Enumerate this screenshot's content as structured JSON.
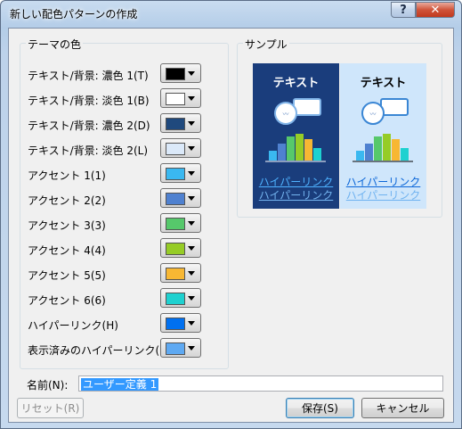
{
  "window": {
    "title": "新しい配色パターンの作成"
  },
  "titlebar": {
    "help_icon": "?",
    "close_icon": "✕"
  },
  "theme_colors": {
    "title": "テーマの色",
    "items": [
      {
        "label": "テキスト/背景: 濃色 1(T)",
        "color": "#000000"
      },
      {
        "label": "テキスト/背景: 淡色 1(B)",
        "color": "#ffffff"
      },
      {
        "label": "テキスト/背景: 濃色 2(D)",
        "color": "#1f497d"
      },
      {
        "label": "テキスト/背景: 淡色 2(L)",
        "color": "#dbe9f9"
      },
      {
        "label": "アクセント 1(1)",
        "color": "#3ab8f0"
      },
      {
        "label": "アクセント 2(2)",
        "color": "#4f81d0"
      },
      {
        "label": "アクセント 3(3)",
        "color": "#56c86b"
      },
      {
        "label": "アクセント 4(4)",
        "color": "#96cc26"
      },
      {
        "label": "アクセント 5(5)",
        "color": "#f7b733"
      },
      {
        "label": "アクセント 6(6)",
        "color": "#1ed1d0"
      },
      {
        "label": "ハイパーリンク(H)",
        "color": "#0070f0"
      },
      {
        "label": "表示済みのハイパーリンク(F)",
        "color": "#5ea9f2"
      }
    ]
  },
  "sample": {
    "title": "サンプル",
    "dark": {
      "heading": "テキスト",
      "bg": "#1a3d7c",
      "link": "ハイパーリンク",
      "visited": "ハイパーリンク"
    },
    "light": {
      "heading": "テキスト",
      "bg": "#cfe6fb",
      "link": "ハイパーリンク",
      "visited": "ハイパーリンク"
    },
    "bars": [
      0.35,
      0.6,
      0.85,
      0.95,
      0.75,
      0.45
    ]
  },
  "name": {
    "label": "名前(N):",
    "value": "ユーザー定義 1"
  },
  "buttons": {
    "reset": "リセット(R)",
    "save": "保存(S)",
    "cancel": "キャンセル"
  }
}
